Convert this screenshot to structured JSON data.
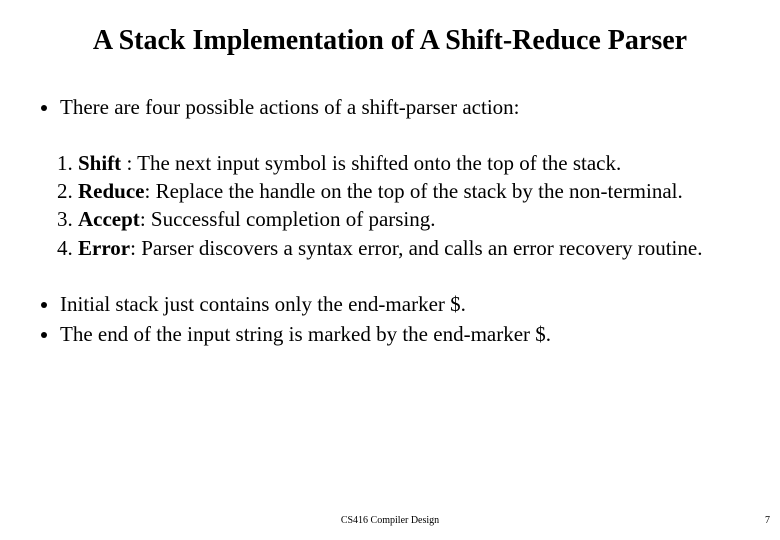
{
  "title": "A Stack Implementation of A Shift-Reduce Parser",
  "intro": "There are four possible actions of a shift-parser action:",
  "items": [
    {
      "label": "Shift",
      "sep": " :  ",
      "text": "The next input symbol is shifted onto the top of the stack."
    },
    {
      "label": "Reduce",
      "sep": ": ",
      "text": "Replace the handle on the top of the stack by the non-terminal."
    },
    {
      "label": "Accept",
      "sep": ": ",
      "text": "Successful completion of parsing."
    },
    {
      "label": "Error",
      "sep": ": ",
      "text": "Parser discovers a syntax error, and calls an error recovery routine."
    }
  ],
  "trailing": [
    "Initial stack just contains only the end-marker $.",
    "The end of the input string is marked by the end-marker $."
  ],
  "footer": "CS416 Compiler Design",
  "page": "7"
}
